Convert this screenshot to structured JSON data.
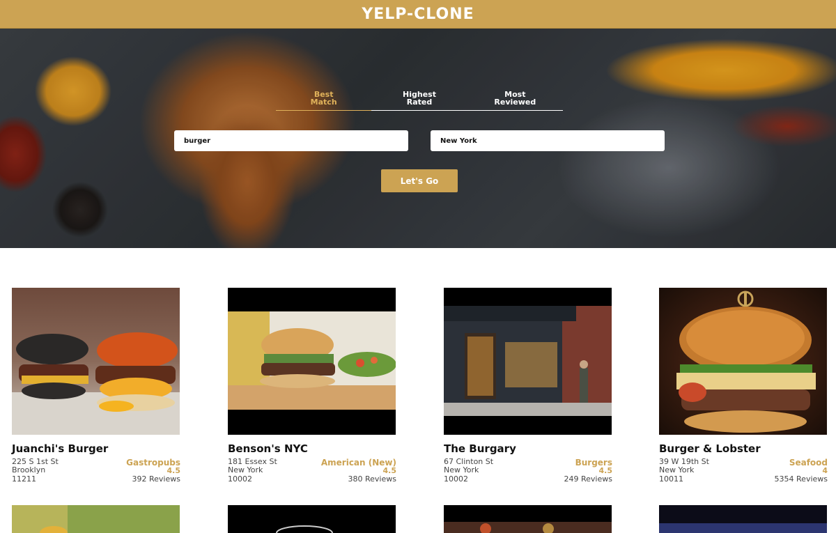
{
  "app": {
    "title": "YELP-CLONE"
  },
  "sort_options": [
    {
      "label": "Best\nMatch",
      "l1": "Best",
      "l2": "Match",
      "active": true
    },
    {
      "label": "Highest\nRated",
      "l1": "Highest",
      "l2": "Rated",
      "active": false
    },
    {
      "label": "Most\nReviewed",
      "l1": "Most",
      "l2": "Reviewed",
      "active": false
    }
  ],
  "search": {
    "term_value": "burger",
    "location_value": "New York",
    "submit_label": "Let's Go"
  },
  "businesses": [
    {
      "name": "Juanchi's Burger",
      "address": "225 S 1st St",
      "city": "Brooklyn",
      "zip": "11211",
      "category": "Gastropubs",
      "rating": "4.5",
      "reviews": "392 Reviews"
    },
    {
      "name": "Benson's NYC",
      "address": "181 Essex St",
      "city": "New York",
      "zip": "10002",
      "category": "American (New)",
      "rating": "4.5",
      "reviews": "380 Reviews"
    },
    {
      "name": "The Burgary",
      "address": "67 Clinton St",
      "city": "New York",
      "zip": "10002",
      "category": "Burgers",
      "rating": "4.5",
      "reviews": "249 Reviews"
    },
    {
      "name": "Burger & Lobster",
      "address": "39 W 19th St",
      "city": "New York",
      "zip": "10011",
      "category": "Seafood",
      "rating": "4",
      "reviews": "5354 Reviews"
    }
  ],
  "colors": {
    "accent": "#cca353",
    "text": "#111111"
  }
}
